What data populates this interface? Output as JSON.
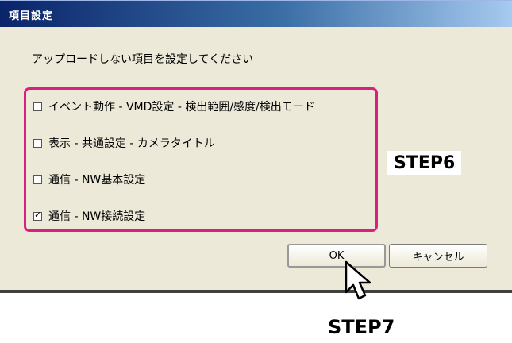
{
  "window": {
    "title": "項目設定"
  },
  "instruction": "アップロードしない項目を設定してください",
  "options": [
    {
      "label": "イベント動作 - VMD設定 - 検出範囲/感度/検出モード",
      "checked": false
    },
    {
      "label": "表示 - 共通設定 - カメラタイトル",
      "checked": false
    },
    {
      "label": "通信 - NW基本設定",
      "checked": false
    },
    {
      "label": "通信 - NW接続設定",
      "checked": true
    }
  ],
  "buttons": {
    "ok_label": "OK",
    "cancel_label": "キャンセル"
  },
  "annotations": {
    "step6": "STEP6",
    "step7": "STEP7",
    "highlight_color": "#d6217e"
  }
}
